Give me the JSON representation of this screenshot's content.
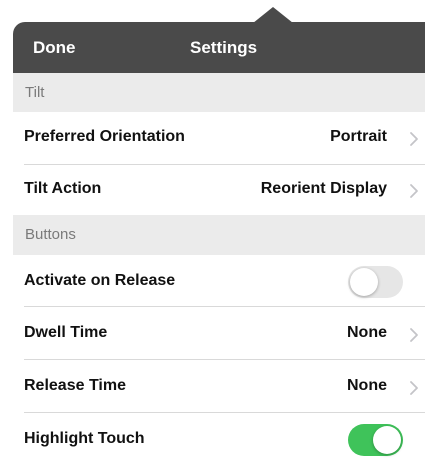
{
  "navbar": {
    "done_label": "Done",
    "title": "Settings"
  },
  "sections": {
    "tilt": {
      "header": "Tilt",
      "preferred_orientation": {
        "label": "Preferred Orientation",
        "value": "Portrait"
      },
      "tilt_action": {
        "label": "Tilt Action",
        "value": "Reorient Display"
      }
    },
    "buttons": {
      "header": "Buttons",
      "activate_on_release": {
        "label": "Activate on Release",
        "enabled": false
      },
      "dwell_time": {
        "label": "Dwell Time",
        "value": "None"
      },
      "release_time": {
        "label": "Release Time",
        "value": "None"
      },
      "highlight_touch": {
        "label": "Highlight Touch",
        "enabled": true
      }
    }
  },
  "colors": {
    "navbar_background": "#4a4a4a",
    "section_header_background": "#ebebeb",
    "toggle_on": "#3fc35a",
    "toggle_off": "#e6e6e6"
  },
  "icons": {
    "disclosure": "chevron-right-icon"
  }
}
